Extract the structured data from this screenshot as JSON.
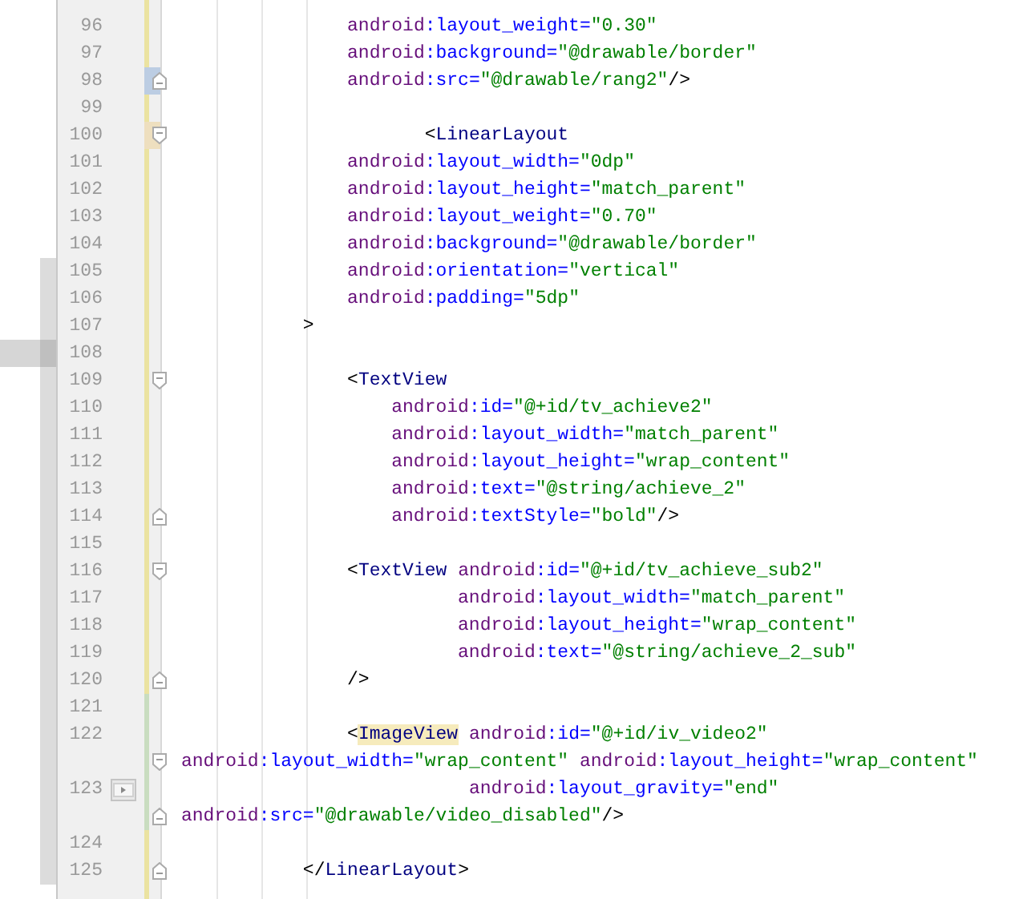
{
  "editor": {
    "lines": [
      {
        "number": "96",
        "kind": "changed",
        "marked": false,
        "selected": false,
        "rows": [
          {
            "kind": "plain",
            "text": "               android:layout_weight=\"0.30\""
          }
        ]
      },
      {
        "number": "97",
        "kind": "changed",
        "marked": false,
        "selected": false,
        "rows": [
          {
            "kind": "plain",
            "text": "               android:background=\"@drawable/border\""
          }
        ]
      },
      {
        "number": "98",
        "kind": "modified",
        "marked": false,
        "selected": false,
        "rows": [
          {
            "kind": "fold_end",
            "text": "               android:src=\"@drawable/rang2\"/>"
          }
        ]
      },
      {
        "number": "99",
        "kind": "changed",
        "marked": false,
        "selected": false,
        "rows": [
          {
            "kind": "plain"
          }
        ]
      },
      {
        "number": "100",
        "kind": "highlight",
        "marked": false,
        "selected": false,
        "rows": [
          {
            "kind": "fold_start",
            "text": "                      <LinearLayout"
          }
        ]
      },
      {
        "number": "101",
        "kind": "changed",
        "marked": false,
        "selected": false,
        "rows": [
          {
            "kind": "plain",
            "text": "               android:layout_width=\"0dp\""
          }
        ]
      },
      {
        "number": "102",
        "kind": "changed",
        "marked": false,
        "selected": false,
        "rows": [
          {
            "kind": "plain",
            "text": "               android:layout_height=\"match_parent\""
          }
        ]
      },
      {
        "number": "103",
        "kind": "changed",
        "marked": false,
        "selected": false,
        "rows": [
          {
            "kind": "plain",
            "text": "               android:layout_weight=\"0.70\""
          }
        ]
      },
      {
        "number": "104",
        "kind": "changed",
        "marked": false,
        "selected": false,
        "rows": [
          {
            "kind": "plain",
            "text": "               android:background=\"@drawable/border\""
          }
        ]
      },
      {
        "number": "105",
        "kind": "changed",
        "marked": true,
        "selected": false,
        "rows": [
          {
            "kind": "plain",
            "text": "               android:orientation=\"vertical\""
          }
        ]
      },
      {
        "number": "106",
        "kind": "changed",
        "marked": true,
        "selected": false,
        "rows": [
          {
            "kind": "plain",
            "text": "               android:padding=\"5dp\""
          }
        ]
      },
      {
        "number": "107",
        "kind": "changed",
        "marked": true,
        "selected": false,
        "rows": [
          {
            "kind": "plain",
            "text": "           >"
          }
        ]
      },
      {
        "number": "108",
        "kind": "changed",
        "marked": true,
        "selected": true,
        "rows": [
          {
            "kind": "plain"
          }
        ]
      },
      {
        "number": "109",
        "kind": "changed",
        "marked": true,
        "selected": false,
        "rows": [
          {
            "kind": "fold_start",
            "text": "               <TextView"
          }
        ]
      },
      {
        "number": "110",
        "kind": "changed",
        "marked": true,
        "selected": false,
        "rows": [
          {
            "kind": "plain",
            "text": "                   android:id=\"@+id/tv_achieve2\""
          }
        ]
      },
      {
        "number": "111",
        "kind": "changed",
        "marked": true,
        "selected": false,
        "rows": [
          {
            "kind": "plain",
            "text": "                   android:layout_width=\"match_parent\""
          }
        ]
      },
      {
        "number": "112",
        "kind": "changed",
        "marked": true,
        "selected": false,
        "rows": [
          {
            "kind": "plain",
            "text": "                   android:layout_height=\"wrap_content\""
          }
        ]
      },
      {
        "number": "113",
        "kind": "changed",
        "marked": true,
        "selected": false,
        "rows": [
          {
            "kind": "plain",
            "text": "                   android:text=\"@string/achieve_2\""
          }
        ]
      },
      {
        "number": "114",
        "kind": "changed",
        "marked": true,
        "selected": false,
        "rows": [
          {
            "kind": "fold_end",
            "text": "                   android:textStyle=\"bold\"/>"
          }
        ]
      },
      {
        "number": "115",
        "kind": "changed",
        "marked": true,
        "selected": false,
        "rows": [
          {
            "kind": "plain"
          }
        ]
      },
      {
        "number": "116",
        "kind": "changed",
        "marked": true,
        "selected": false,
        "rows": [
          {
            "kind": "fold_start",
            "text": "               <TextView android:id=\"@+id/tv_achieve_sub2\""
          }
        ]
      },
      {
        "number": "117",
        "kind": "changed",
        "marked": true,
        "selected": false,
        "rows": [
          {
            "kind": "plain",
            "text": "                         android:layout_width=\"match_parent\""
          }
        ]
      },
      {
        "number": "118",
        "kind": "changed",
        "marked": true,
        "selected": false,
        "rows": [
          {
            "kind": "plain",
            "text": "                         android:layout_height=\"wrap_content\""
          }
        ]
      },
      {
        "number": "119",
        "kind": "changed",
        "marked": true,
        "selected": false,
        "rows": [
          {
            "kind": "plain",
            "text": "                         android:text=\"@string/achieve_2_sub\""
          }
        ]
      },
      {
        "number": "120",
        "kind": "changed",
        "marked": true,
        "selected": false,
        "rows": [
          {
            "kind": "fold_end",
            "text": "               />"
          }
        ]
      },
      {
        "number": "121",
        "kind": "added",
        "marked": true,
        "selected": false,
        "rows": [
          {
            "kind": "plain"
          }
        ]
      },
      {
        "number": "122",
        "kind": "added",
        "marked": true,
        "selected": false,
        "rows": [
          {
            "kind": "plain",
            "tag_highlighted": true,
            "text": "               <ImageView android:id=\"@+id/iv_video2\""
          }
        ]
      },
      {
        "number": "123",
        "kind": "added",
        "marked": true,
        "selected": false,
        "video_preview": true,
        "rows": [
          {
            "kind": "fold_start",
            "text": "android:layout_width=\"wrap_content\" android:layout_height=\"wrap_content\""
          },
          {
            "kind": "plain",
            "text": "                          android:layout_gravity=\"end\""
          },
          {
            "kind": "fold_end",
            "text": "android:src=\"@drawable/video_disabled\"/>"
          }
        ]
      },
      {
        "number": "124",
        "kind": "changed",
        "marked": true,
        "selected": false,
        "rows": [
          {
            "kind": "plain"
          }
        ]
      },
      {
        "number": "125",
        "kind": "changed",
        "marked": true,
        "selected": false,
        "rows": [
          {
            "kind": "fold_end",
            "text": "           </LinearLayout>"
          }
        ]
      }
    ]
  }
}
